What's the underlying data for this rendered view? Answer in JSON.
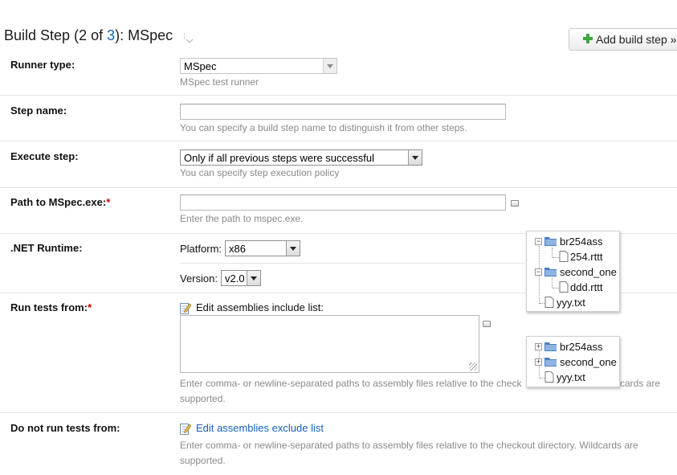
{
  "header": {
    "title_prefix": "Build Step (",
    "step_current": "2",
    "of_text": " of ",
    "step_total": "3",
    "title_suffix": "): MSpec",
    "add_button": "Add build step »"
  },
  "runner_type": {
    "label": "Runner type:",
    "value": "MSpec",
    "hint": "MSpec test runner"
  },
  "step_name": {
    "label": "Step name:",
    "value": "",
    "hint": "You can specify a build step name to distinguish it from other steps."
  },
  "execute_step": {
    "label": "Execute step:",
    "value": "Only if all previous steps were successful",
    "hint": "You can specify step execution policy"
  },
  "mspec_path": {
    "label": "Path to MSpec.exe:",
    "required_mark": "*",
    "value": "",
    "hint": "Enter the path to mspec.exe."
  },
  "net_runtime": {
    "label": ".NET Runtime:",
    "platform_label": "Platform:",
    "platform_value": "x86",
    "version_label": "Version:",
    "version_value": "v2.0"
  },
  "run_tests_from": {
    "label": "Run tests from:",
    "required_mark": "*",
    "edit_link": "Edit assemblies include list:",
    "value": "",
    "hint_line1": "Enter comma- or newline-separated paths to assembly files relative to the check",
    "hint_line1_tail": "cards are",
    "hint_line2": "supported."
  },
  "do_not_run": {
    "label": "Do not run tests from:",
    "edit_link": "Edit assemblies exclude list",
    "hint_line1": "Enter comma- or newline-separated paths to assembly files relative to the checkout directory. Wildcards are",
    "hint_line2": "supported."
  },
  "tree_expanded": {
    "items": [
      {
        "label": "br254ass",
        "toggle": "−"
      },
      {
        "label": "254.rttt"
      },
      {
        "label": "second_one",
        "toggle": "−"
      },
      {
        "label": "ddd.rttt"
      },
      {
        "label": "yyy.txt"
      }
    ]
  },
  "tree_collapsed": {
    "items": [
      {
        "label": "br254ass",
        "toggle": "+"
      },
      {
        "label": "second_one",
        "toggle": "+"
      },
      {
        "label": "yyy.txt"
      }
    ]
  },
  "colors": {
    "link": "#1560bd",
    "required": "#cc0000",
    "hint": "#8a8a8a"
  }
}
